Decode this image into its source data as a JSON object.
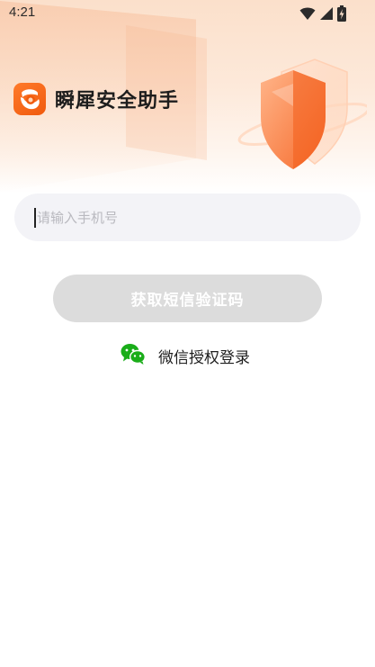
{
  "status_bar": {
    "time": "4:21",
    "icons": [
      "wifi-icon",
      "cell-signal-icon",
      "battery-charging-icon"
    ]
  },
  "header": {
    "app_name": "瞬犀安全助手",
    "logo_icon": "app-logo-icon",
    "illustration_icon": "shield-icon"
  },
  "login": {
    "phone_placeholder": "请输入手机号",
    "phone_value": "",
    "get_code_label": "获取短信验证码",
    "wechat_login_label": "微信授权登录",
    "wechat_icon": "wechat-icon"
  },
  "colors": {
    "brand_orange": "#f26a1b",
    "wechat_green": "#1aad19",
    "button_disabled": "#dcdcdc",
    "input_bg": "#f3f3f7"
  }
}
